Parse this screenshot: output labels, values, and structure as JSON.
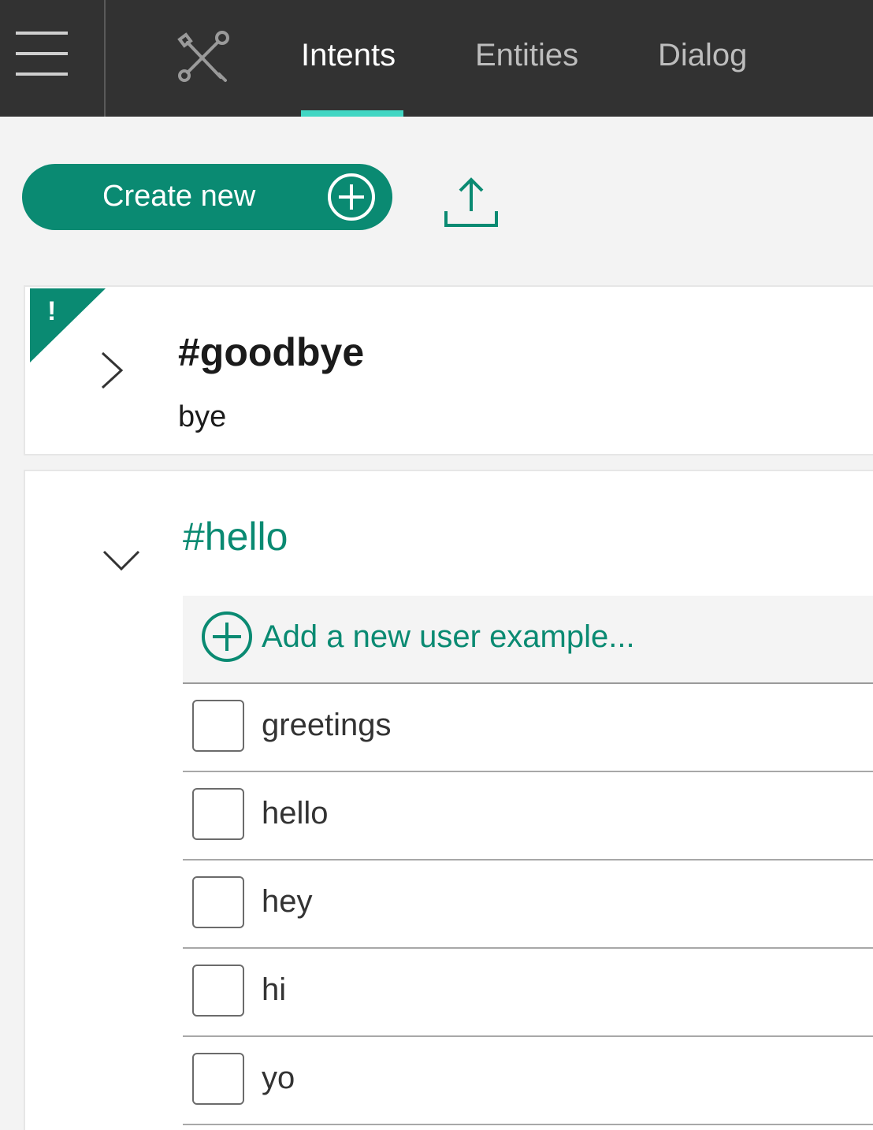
{
  "colors": {
    "topbar": "#323232",
    "accent": "#0a8a72",
    "tab_indicator": "#41d6c3"
  },
  "nav": {
    "menu_icon": "hamburger-menu-icon",
    "tools_icon": "wrench-screwdriver-icon",
    "tabs": [
      {
        "label": "Intents",
        "active": true
      },
      {
        "label": "Entities",
        "active": false
      },
      {
        "label": "Dialog",
        "active": false
      }
    ]
  },
  "toolbar": {
    "create_label": "Create new",
    "create_icon": "plus-circle-icon",
    "upload_icon": "upload-icon"
  },
  "intents": [
    {
      "name": "#goodbye",
      "description": "bye",
      "flag": "!",
      "expanded": false
    },
    {
      "name": "#hello",
      "expanded": true,
      "add_example_label": "Add a new user example...",
      "examples": [
        "greetings",
        "hello",
        "hey",
        "hi",
        "yo"
      ]
    }
  ]
}
